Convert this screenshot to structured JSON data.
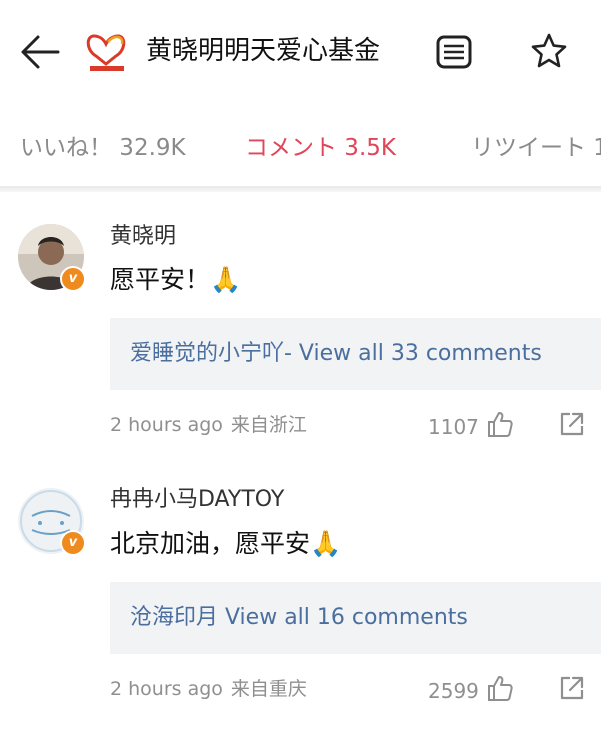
{
  "header": {
    "title": "黄晓明明天爱心基金",
    "icons": [
      "back-arrow-icon",
      "foundation-logo",
      "menu-icon",
      "star-icon"
    ]
  },
  "tabs": [
    {
      "label": "いいね！ 32.9K",
      "active": false
    },
    {
      "label": "コメント 3.5K",
      "active": true
    },
    {
      "label": "リツイート 1",
      "active": false
    }
  ],
  "colors": {
    "accent": "#e0455a",
    "link": "#4a6f9f",
    "badge": "#ee8a1e",
    "muted": "#8f8f8f"
  },
  "comments": [
    {
      "username": "黄晓明",
      "text": "愿平安！🙏",
      "replies": "爱睡觉的小宁吖- View all 33 comments",
      "time": "2 hours ago",
      "location": "来自浙江",
      "likes": "1107"
    },
    {
      "username": "冉冉小马DAYTOY",
      "text": "北京加油，愿平安🙏",
      "replies": "沧海印月 View all 16 comments",
      "time": "2 hours ago",
      "location": "来自重庆",
      "likes": "2599"
    }
  ]
}
